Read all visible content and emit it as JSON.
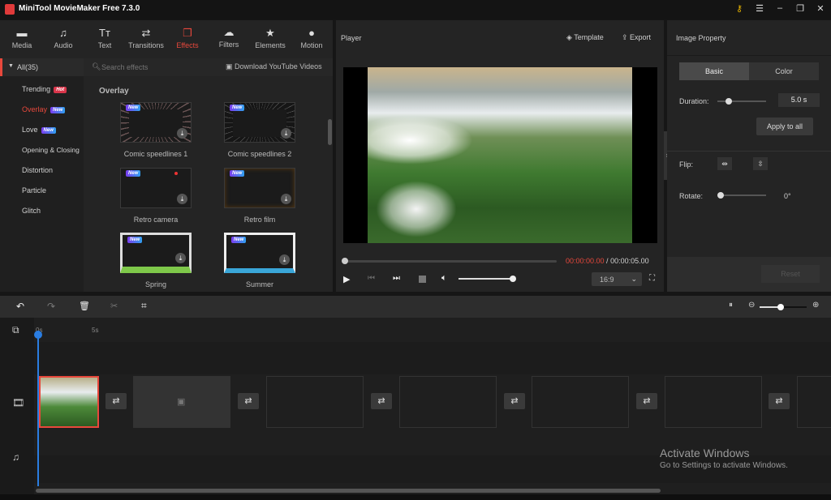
{
  "app": {
    "title": "MiniTool MovieMaker Free 7.3.0"
  },
  "toolbar_tabs": [
    {
      "label": "Media",
      "icon": "folder-icon"
    },
    {
      "label": "Audio",
      "icon": "music-icon"
    },
    {
      "label": "Text",
      "icon": "text-icon"
    },
    {
      "label": "Transitions",
      "icon": "transitions-icon"
    },
    {
      "label": "Effects",
      "icon": "effects-icon",
      "active": true
    },
    {
      "label": "Filters",
      "icon": "filters-icon"
    },
    {
      "label": "Elements",
      "icon": "elements-icon"
    },
    {
      "label": "Motion",
      "icon": "motion-icon"
    }
  ],
  "effects": {
    "all_label": "All(35)",
    "search_placeholder": "Search effects",
    "download_label": "Download YouTube Videos",
    "section_title": "Overlay",
    "categories": [
      {
        "label": "Trending",
        "badge": "Hot"
      },
      {
        "label": "Overlay",
        "badge": "New",
        "active": true
      },
      {
        "label": "Love",
        "badge": "New"
      },
      {
        "label": "Opening & Closing"
      },
      {
        "label": "Distortion"
      },
      {
        "label": "Particle"
      },
      {
        "label": "Glitch"
      }
    ],
    "items": [
      {
        "label": "Comic speedlines 1",
        "badge": "New"
      },
      {
        "label": "Comic speedlines 2",
        "badge": "New"
      },
      {
        "label": "Retro camera",
        "badge": "New"
      },
      {
        "label": "Retro film",
        "badge": "New"
      },
      {
        "label": "Spring",
        "badge": "New"
      },
      {
        "label": "Summer",
        "badge": "New"
      }
    ]
  },
  "player": {
    "title": "Player",
    "template_label": "Template",
    "export_label": "Export",
    "current_time": "00:00:00.00",
    "separator": " / ",
    "total_time": "00:00:05.00",
    "aspect_ratio": "16:9",
    "volume": 1.0,
    "progress": 0
  },
  "property": {
    "title": "Image Property",
    "tabs": [
      "Basic",
      "Color"
    ],
    "duration_label": "Duration:",
    "duration_value": "5.0 s",
    "apply_all_label": "Apply to all",
    "flip_label": "Flip:",
    "rotate_label": "Rotate:",
    "rotate_value": "0°",
    "reset_label": "Reset"
  },
  "timeline": {
    "ruler": [
      "0s",
      "5s"
    ],
    "zoom_level": 0.45
  },
  "watermark": {
    "line1": "Activate Windows",
    "line2": "Go to Settings to activate Windows."
  },
  "colors": {
    "accent": "#e8483c",
    "bg": "#242424"
  }
}
